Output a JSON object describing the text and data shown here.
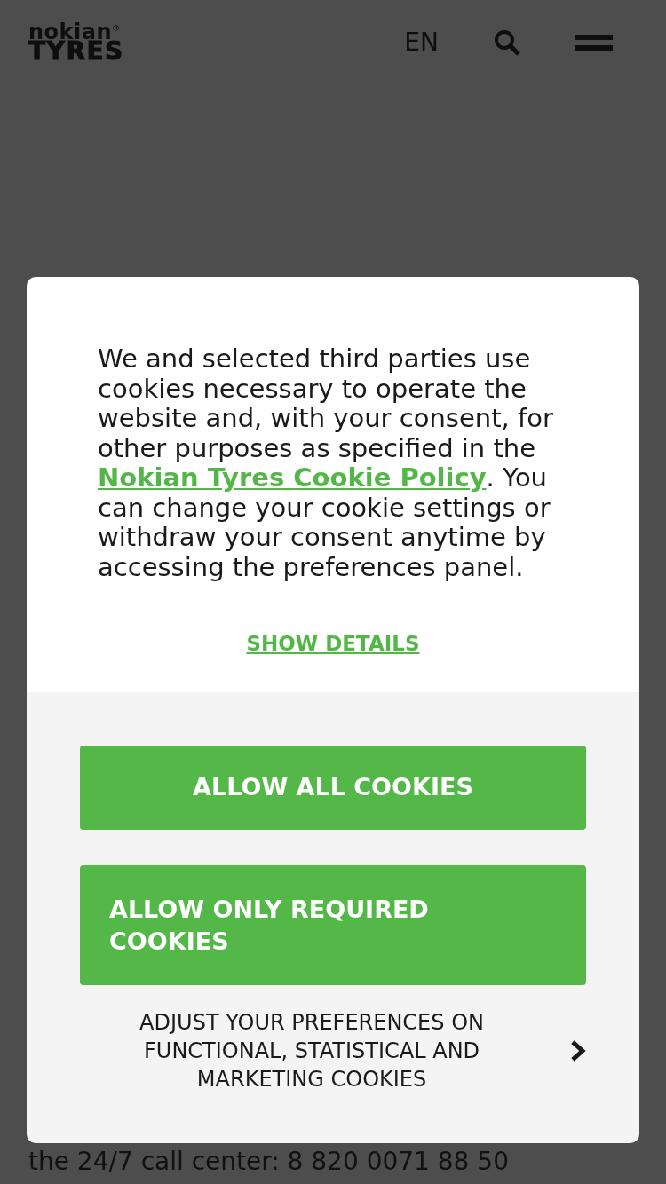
{
  "header": {
    "logo": {
      "line_1": "nokian$^{®}$",
      "line_2": "TYRES"
    },
    "language": "EN"
  },
  "cookie_dialog": {
    "message": {
      "before": "We and selected third parties use cookies necessary to operate the website and, with your consent, for other purposes as specified in the ",
      "link": "Nokian Tyres Cookie Policy",
      "after": ". You can change your cookie settings or withdraw your consent anytime by accessing the preferences panel."
    },
    "details_link": "SHOW DETAILS",
    "buttons": [
      "ALLOW ALL COOKIES",
      "ALLOW ONLY REQUIRED COOKIES"
    ],
    "preferences_link": "ADJUST YOUR PREFERENCES ON FUNCTIONAL, STATISTICAL AND MARKETING COOKIES"
  },
  "page_text": "the 24/7 call center: 8 820 0071 88 50"
}
